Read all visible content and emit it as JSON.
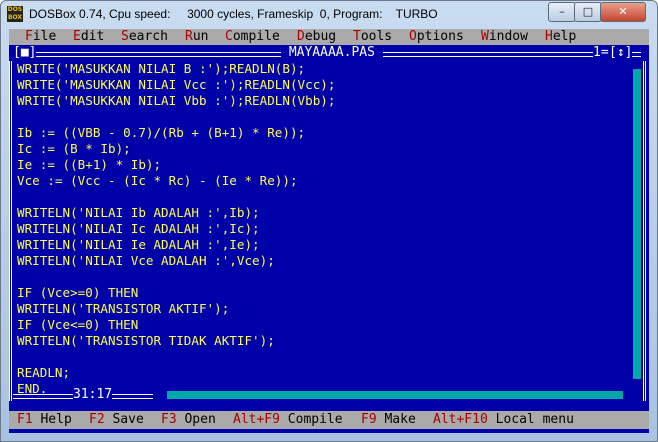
{
  "window": {
    "app_icon_text": "DOS BOX",
    "title": "DOSBox 0.74, Cpu speed:     3000 cycles, Frameskip  0, Program:    TURBO",
    "min_symbol": "–",
    "max_symbol": "□",
    "close_symbol": "✕"
  },
  "menu": [
    {
      "hot": "F",
      "rest": "ile"
    },
    {
      "hot": "E",
      "rest": "dit"
    },
    {
      "hot": "S",
      "rest": "earch"
    },
    {
      "hot": "R",
      "rest": "un"
    },
    {
      "hot": "C",
      "rest": "ompile"
    },
    {
      "hot": "D",
      "rest": "ebug"
    },
    {
      "hot": "T",
      "rest": "ools"
    },
    {
      "hot": "O",
      "rest": "ptions"
    },
    {
      "hot": "W",
      "rest": "indow"
    },
    {
      "hot": "H",
      "rest": "elp"
    }
  ],
  "editor": {
    "close_box": "[■]",
    "file_name": " MAYAAAA.PAS ",
    "window_number": "1=",
    "zoom_box": "[↕]",
    "cursor_position": "31:17",
    "lines": [
      "WRITE('MASUKKAN NILAI B :');READLN(B);",
      "WRITE('MASUKKAN NILAI Vcc :');READLN(Vcc);",
      "WRITE('MASUKKAN NILAI Vbb :');READLN(Vbb);",
      "",
      "Ib := ((VBB - 0.7)/(Rb + (B+1) * Re));",
      "Ic := (B * Ib);",
      "Ie := ((B+1) * Ib);",
      "Vce := (Vcc - (Ic * Rc) - (Ie * Re));",
      "",
      "WRITELN('NILAI Ib ADALAH :',Ib);",
      "WRITELN('NILAI Ic ADALAH :',Ic);",
      "WRITELN('NILAI Ie ADALAH :',Ie);",
      "WRITELN('NILAI Vce ADALAH :',Vce);",
      "",
      "IF (Vce>=0) THEN",
      "WRITELN('TRANSISTOR AKTIF');",
      "IF (Vce<=0) THEN",
      "WRITELN('TRANSISTOR TIDAK AKTIF');",
      "",
      "READLN;",
      "END."
    ]
  },
  "statusbar": [
    {
      "key": "F1",
      "label": " Help"
    },
    {
      "key": "F2",
      "label": " Save"
    },
    {
      "key": "F3",
      "label": " Open"
    },
    {
      "key": "Alt+F9",
      "label": " Compile"
    },
    {
      "key": "F9",
      "label": " Make"
    },
    {
      "key": "Alt+F10",
      "label": " Local menu"
    }
  ]
}
